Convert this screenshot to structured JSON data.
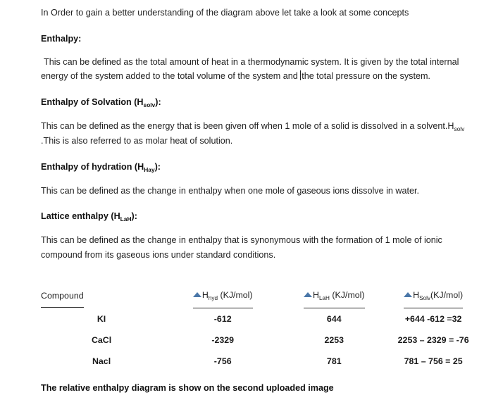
{
  "document": {
    "intro": "In Order to gain a better understanding of the diagram above let take a look at some concepts",
    "sections": [
      {
        "heading_text": "Enthalpy:",
        "heading_base": "Enthalpy",
        "heading_sub": "",
        "body": " This can be defined as the total amount of heat in a thermodynamic system. It is given by the total internal energy of the system added to the total volume of the system and ",
        "body_after_caret": "the total pressure on the system."
      },
      {
        "heading_base": "Enthalpy of Solvation (H",
        "heading_sub": "solv",
        "heading_tail": "):",
        "body_part1": "   This can be defined as the energy that is been given off when 1 mole of a solid is dissolved in a solvent.H",
        "body_sub": "solv",
        "body_part2": " .This is also referred to as molar heat of solution."
      },
      {
        "heading_base": "Enthalpy of hydration (H",
        "heading_sub": "Hay",
        "heading_tail": "):",
        "body": "This can be defined as the change in enthalpy when one mole of gaseous ions dissolve in water."
      },
      {
        "heading_base": "Lattice enthalpy (H",
        "heading_sub": "LaH",
        "heading_tail": "):",
        "body": "This can be defined as the change in enthalpy that is synonymous with the formation of 1 mole of ionic compound from its gaseous ions under standard conditions."
      }
    ],
    "footer": "The relative enthalpy diagram is show on the second uploaded image"
  },
  "table": {
    "headers": [
      {
        "has_delta": false,
        "base": "Compound",
        "sub": "",
        "tail": ""
      },
      {
        "has_delta": true,
        "base": "H",
        "sub": "hyd",
        "tail": " (KJ/mol)"
      },
      {
        "has_delta": true,
        "base": "H",
        "sub": "LaH",
        "tail": " (KJ/mol)"
      },
      {
        "has_delta": true,
        "base": "H",
        "sub": "Solv",
        "tail": "(KJ/mol)"
      }
    ],
    "rows": [
      {
        "compound": "KI",
        "hyd": "-612",
        "lah": "644",
        "solv": "+644 -612 =32"
      },
      {
        "compound": "CaCl",
        "hyd": "-2329",
        "lah": "2253",
        "solv": "2253 – 2329 = -76"
      },
      {
        "compound": "Nacl",
        "hyd": "-756",
        "lah": "781",
        "solv": "781 – 756  = 25"
      }
    ]
  },
  "colors": {
    "delta_icon": "#4a77a8",
    "text": "#1f1f1f",
    "background": "#ffffff"
  }
}
